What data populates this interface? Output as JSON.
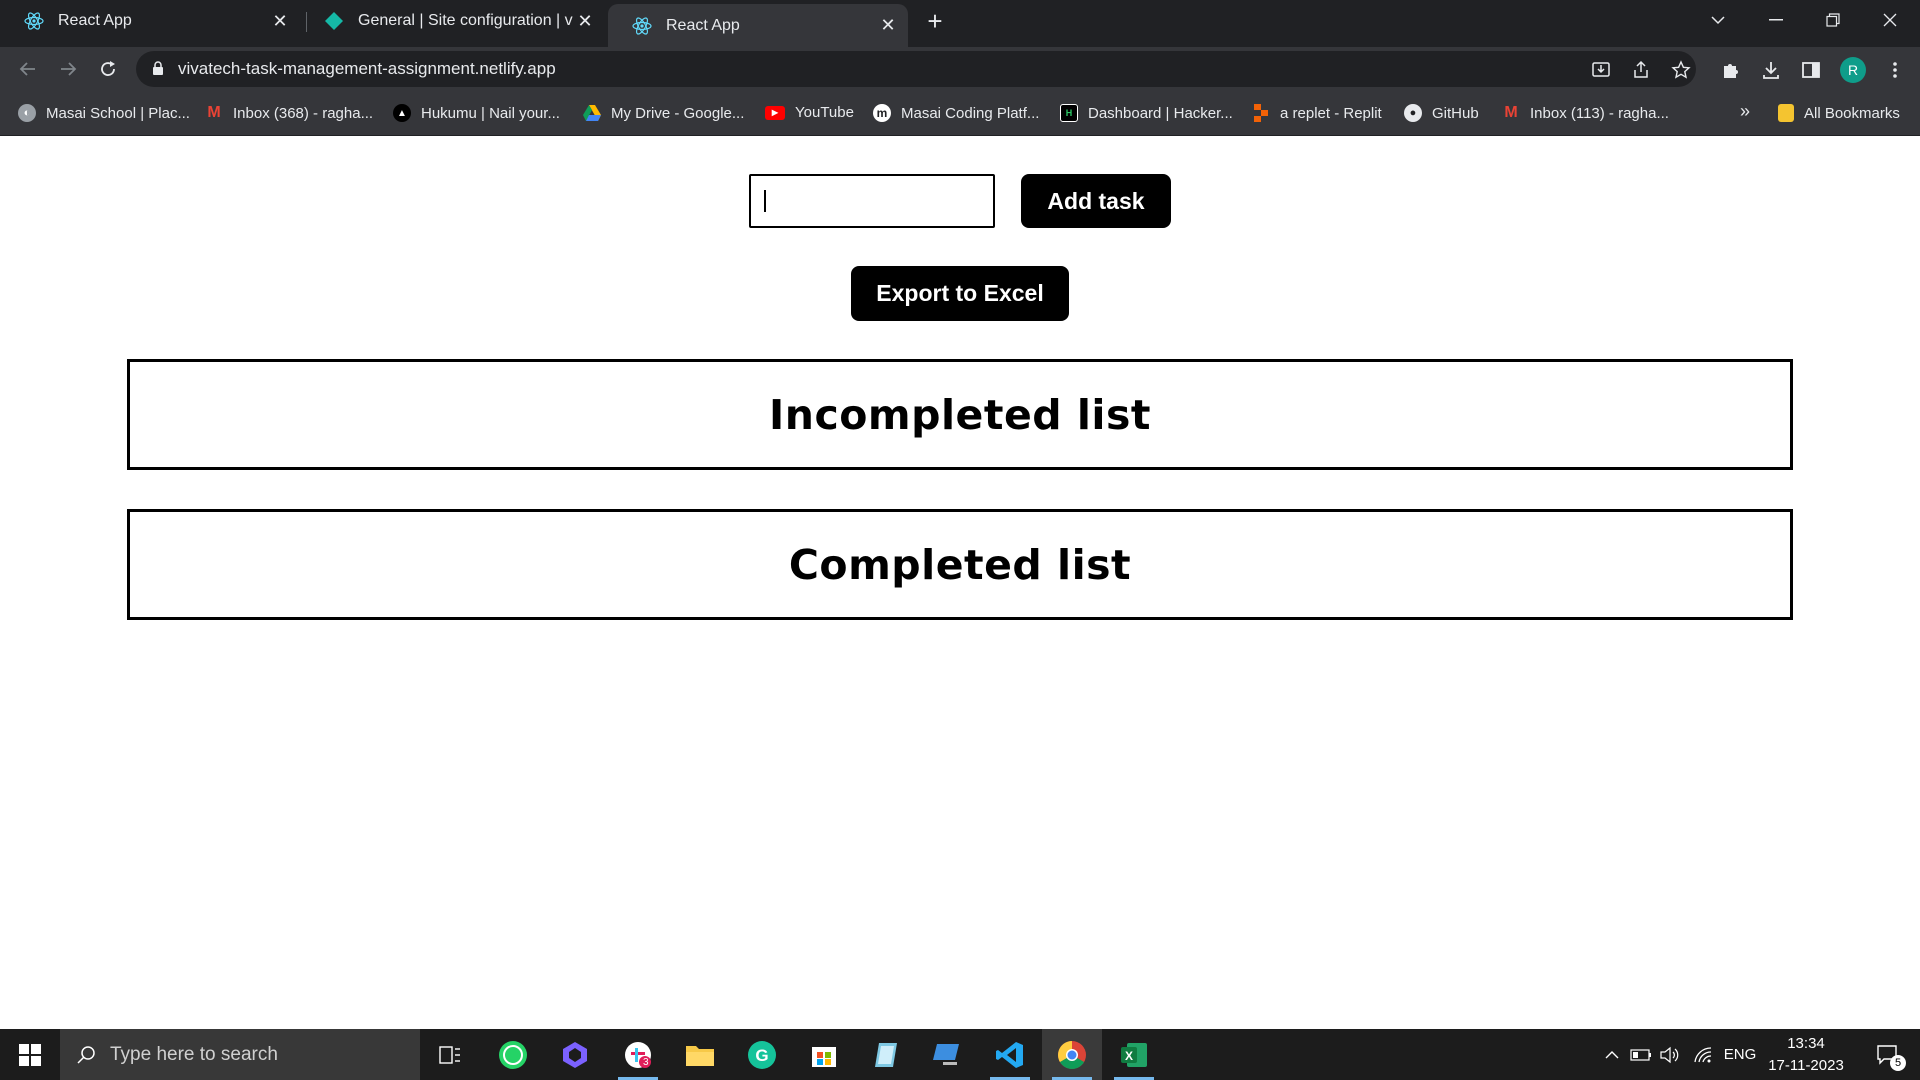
{
  "browser": {
    "tabs": [
      {
        "title": "React App"
      },
      {
        "title": "General | Site configuration | viv"
      },
      {
        "title": "React App"
      }
    ],
    "url": "vivatech-task-management-assignment.netlify.app",
    "profile_initial": "R",
    "bookmarks": [
      {
        "label": "Masai School | Plac...",
        "icon": "masai-school-icon"
      },
      {
        "label": "Inbox (368) - ragha...",
        "icon": "gmail-icon"
      },
      {
        "label": "Hukumu | Nail your...",
        "icon": "hukumu-icon"
      },
      {
        "label": "My Drive - Google...",
        "icon": "google-drive-icon"
      },
      {
        "label": "YouTube",
        "icon": "youtube-icon"
      },
      {
        "label": "Masai Coding Platf...",
        "icon": "masai-coding-icon"
      },
      {
        "label": "Dashboard | Hacker...",
        "icon": "hackerrank-icon"
      },
      {
        "label": "a replet - Replit",
        "icon": "replit-icon"
      },
      {
        "label": "GitHub",
        "icon": "github-icon"
      },
      {
        "label": "Inbox (113) - ragha...",
        "icon": "gmail-icon"
      }
    ],
    "overflow_label": "»",
    "all_bookmarks": "All Bookmarks"
  },
  "page": {
    "task_input": {
      "value": "",
      "placeholder": ""
    },
    "add_task_label": "Add task",
    "export_label": "Export to Excel",
    "incompleted_title": "Incompleted list",
    "completed_title": "Completed list"
  },
  "taskbar": {
    "search_placeholder": "Type here to search",
    "language": "ENG",
    "time": "13:34",
    "date": "17-11-2023",
    "notification_count": "5",
    "slack_badge": "3"
  },
  "colors": {
    "chrome_dark": "#202124",
    "chrome_toolbar": "#35363a",
    "button_bg": "#000000",
    "taskbar_bg": "#1c1c1c"
  }
}
